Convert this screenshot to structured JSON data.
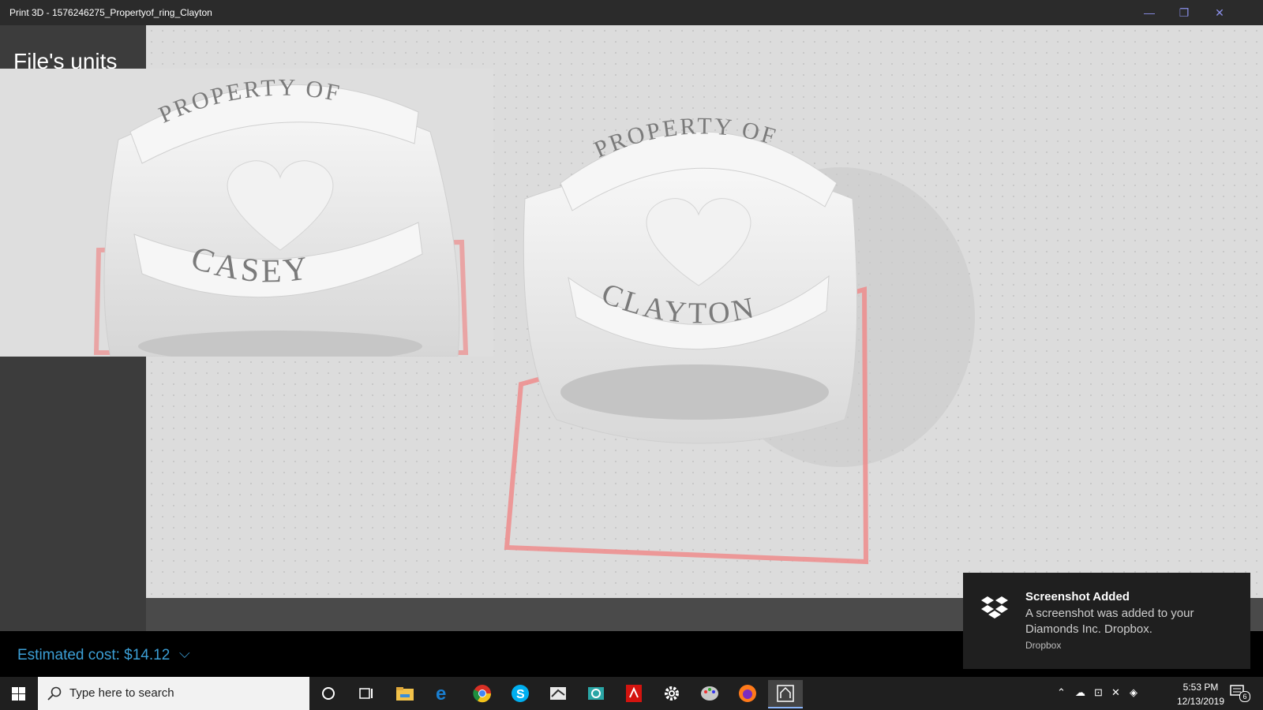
{
  "window": {
    "title": "Print 3D - 1576246275_Propertyof_ring_Clayton",
    "minimize_glyph": "—",
    "maximize_glyph": "❐",
    "close_glyph": "✕"
  },
  "left_panel": {
    "heading": "File's units"
  },
  "preview_ring": {
    "top_text": "PROPERTY OF",
    "name_text": "CASEY"
  },
  "main_ring": {
    "top_text": "PROPERTY OF",
    "name_text": "CLAYTON"
  },
  "cost": {
    "label": "Estimated cost: $14.12",
    "chevron": "⌵"
  },
  "toast": {
    "title": "Screenshot Added",
    "body": "A screenshot was added to your Diamonds Inc. Dropbox.",
    "source": "Dropbox"
  },
  "taskbar": {
    "search_placeholder": "Type here to search",
    "icons": [
      "cortana-icon",
      "task-view-icon",
      "file-explorer-icon",
      "edge-icon",
      "chrome-icon",
      "skype-icon",
      "app-icon",
      "photos-icon",
      "acrobat-icon",
      "settings-icon",
      "paint-icon",
      "firefox-icon",
      "print3d-icon"
    ],
    "time": "5:53 PM",
    "date": "12/13/2019",
    "notification_count": "6"
  },
  "colors": {
    "accent": "#3c9fd6",
    "bed_outline": "#ee8c8c"
  }
}
